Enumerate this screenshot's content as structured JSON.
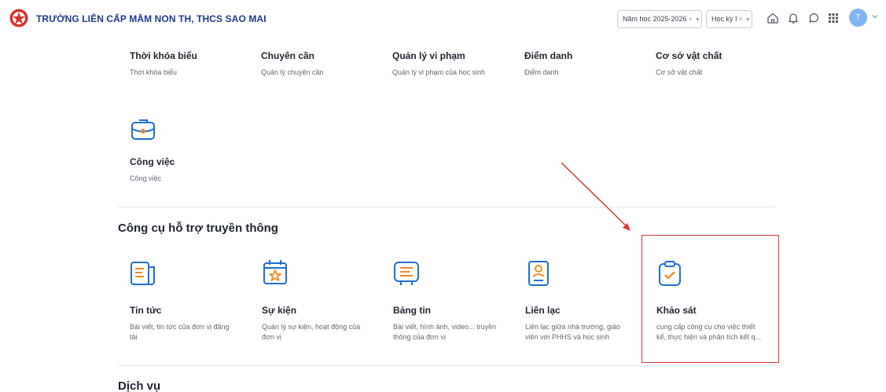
{
  "header": {
    "school_name": "TRƯỜNG LIÊN CẤP MẦM NON TH, THCS SAO MAI",
    "year_select": "Năm học 2025-2026",
    "term_select": "Học kỳ I",
    "avatar_initial": "T"
  },
  "top_items": [
    {
      "title": "Thời khóa biểu",
      "desc": "Thời khóa biểu"
    },
    {
      "title": "Chuyên cần",
      "desc": "Quản lý chuyên cần"
    },
    {
      "title": "Quản lý vi phạm",
      "desc": "Quản lý vi phạm của học sinh"
    },
    {
      "title": "Điểm danh",
      "desc": "Điểm danh"
    },
    {
      "title": "Cơ sở vật chất",
      "desc": "Cơ sở vật chất"
    }
  ],
  "work_item": {
    "title": "Công việc",
    "desc": "Công việc",
    "icon": "briefcase-icon"
  },
  "comm_section": {
    "title": "Công cụ hỗ trợ truyền thông",
    "items": [
      {
        "title": "Tin tức",
        "desc": "Bài viết, tin tức của đơn vị đăng tải",
        "icon": "news-icon"
      },
      {
        "title": "Sự kiện",
        "desc": "Quản lý sự kiện, hoạt động của đơn vị",
        "icon": "calendar-star-icon"
      },
      {
        "title": "Bảng tin",
        "desc": "Bài viết, hình ảnh, video... truyền thông của đơn vị",
        "icon": "bulletin-icon"
      },
      {
        "title": "Liên lạc",
        "desc": "Liên lạc giữa nhà trường, giáo viên với PHHS và học sinh",
        "icon": "contact-card-icon"
      },
      {
        "title": "Khảo sát",
        "desc": "cung cấp công cụ cho việc thiết kế, thực hiện và phân tích kết q...",
        "icon": "clipboard-check-icon"
      }
    ]
  },
  "services_section": {
    "title": "Dịch vụ"
  },
  "colors": {
    "icon_blue": "#1f6fd1",
    "icon_orange": "#f08a1c",
    "highlight_red": "#d63a3a",
    "brand_navy": "#1d3a8a"
  }
}
